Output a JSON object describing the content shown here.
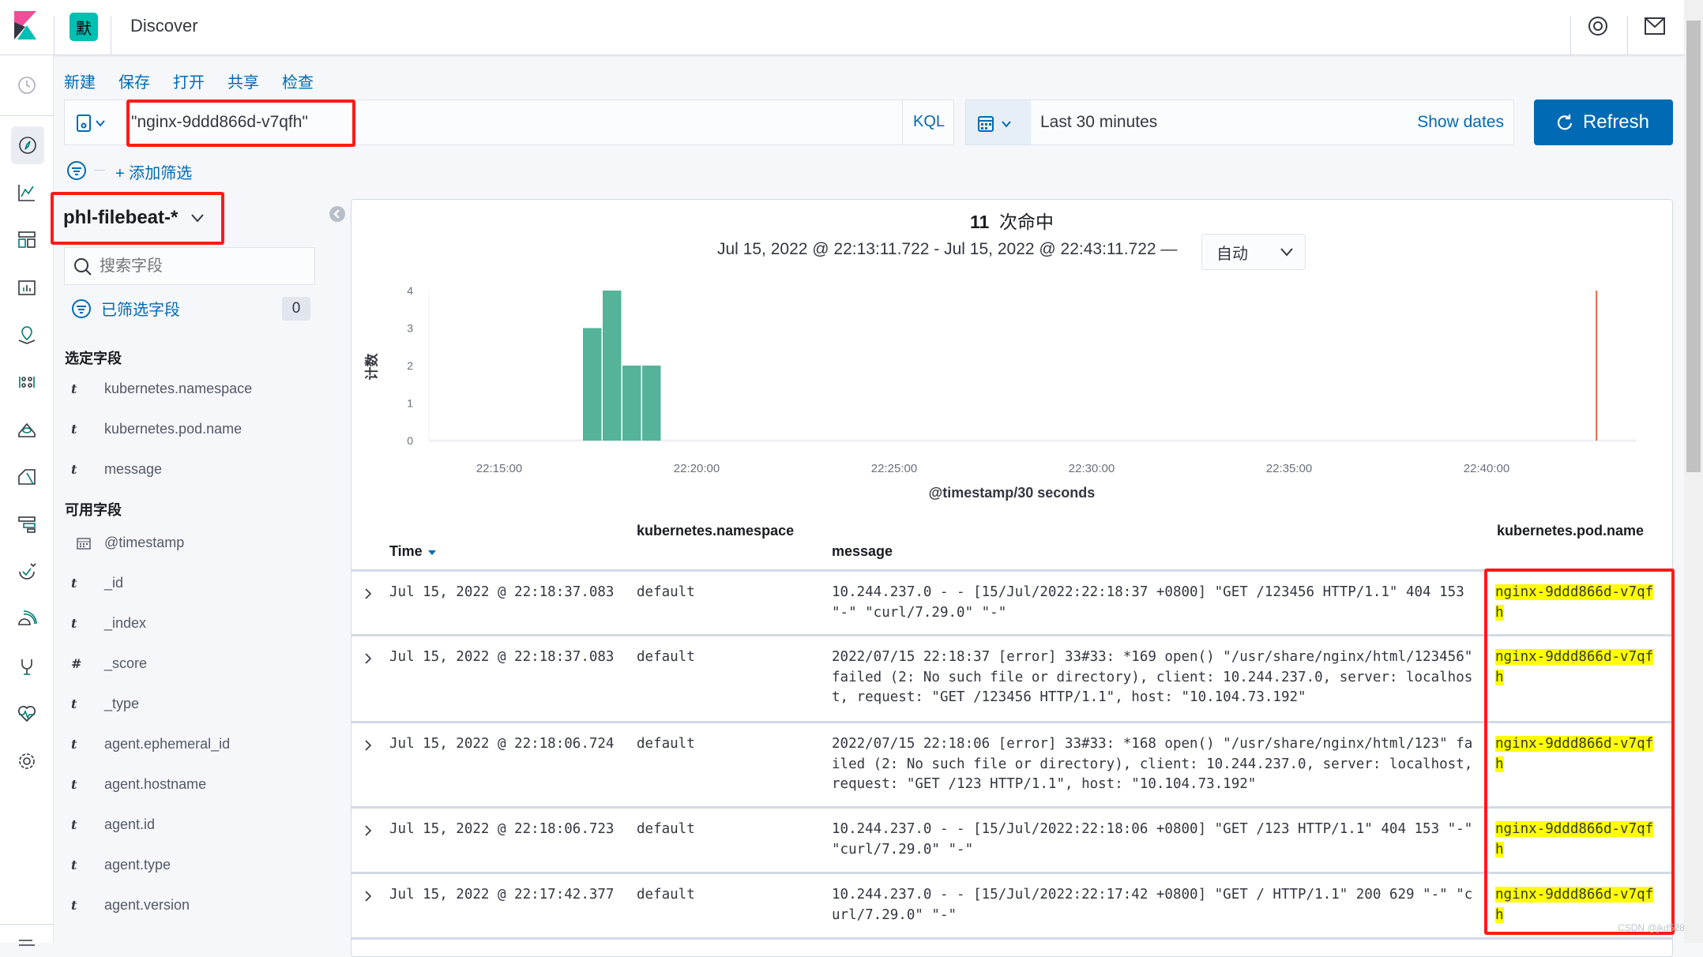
{
  "header": {
    "space_avatar": "默",
    "title": "Discover",
    "help_icon": "lifebuoy-icon",
    "mail_icon": "mail-icon"
  },
  "menu": {
    "new": "新建",
    "save": "保存",
    "open": "打开",
    "share": "共享",
    "inspect": "检查"
  },
  "query": {
    "value": "\"nginx-9ddd866d-v7qfh\"",
    "language": "KQL"
  },
  "time": {
    "range": "Last 30 minutes",
    "show_dates": "Show dates",
    "refresh": "Refresh"
  },
  "filter": {
    "add": "+ 添加筛选"
  },
  "sidebar": {
    "index_pattern": "phl-filebeat-*",
    "search_placeholder": "搜索字段",
    "filtered_label": "已筛选字段",
    "filtered_count": "0",
    "selected_title": "选定字段",
    "selected": [
      {
        "type": "t",
        "name": "kubernetes.namespace"
      },
      {
        "type": "t",
        "name": "kubernetes.pod.name"
      },
      {
        "type": "t",
        "name": "message"
      }
    ],
    "available_title": "可用字段",
    "available": [
      {
        "type": "date",
        "name": "@timestamp"
      },
      {
        "type": "t",
        "name": "_id"
      },
      {
        "type": "t",
        "name": "_index"
      },
      {
        "type": "#",
        "name": "_score"
      },
      {
        "type": "t",
        "name": "_type"
      },
      {
        "type": "t",
        "name": "agent.ephemeral_id"
      },
      {
        "type": "t",
        "name": "agent.hostname"
      },
      {
        "type": "t",
        "name": "agent.id"
      },
      {
        "type": "t",
        "name": "agent.type"
      },
      {
        "type": "t",
        "name": "agent.version"
      }
    ]
  },
  "hits": {
    "count": "11",
    "label": "次命中",
    "range": "Jul 15, 2022 @ 22:13:11.722 - Jul 15, 2022 @ 22:43:11.722 —",
    "interval": "自动"
  },
  "chart_data": {
    "type": "bar",
    "xlabel": "@timestamp/30 seconds",
    "ylabel": "计数",
    "x": [
      "22:17:30",
      "22:18:00",
      "22:18:30",
      "22:19:00"
    ],
    "values": [
      3,
      4,
      2,
      2
    ],
    "ylim": [
      0,
      4
    ],
    "yticks": [
      "0",
      "1",
      "2",
      "3",
      "4"
    ],
    "xticks": [
      "22:15:00",
      "22:20:00",
      "22:25:00",
      "22:30:00",
      "22:35:00",
      "22:40:00"
    ],
    "now_marker": "22:43:11",
    "bar_color": "#54b399",
    "marker_color": "#e7664c",
    "grid": false
  },
  "table": {
    "headers": {
      "time": "Time",
      "namespace": "kubernetes.namespace",
      "message": "message",
      "pod": "kubernetes.pod.name"
    },
    "rows": [
      {
        "time": "Jul 15, 2022 @ 22:18:37.083",
        "namespace": "default",
        "message": "10.244.237.0 - - [15/Jul/2022:22:18:37 +0800] \"GET /123456 HTTP/1.1\" 404 153 \"-\" \"curl/7.29.0\" \"-\"",
        "pod": "nginx-9ddd866d-v7qfh"
      },
      {
        "time": "Jul 15, 2022 @ 22:18:37.083",
        "namespace": "default",
        "message": "2022/07/15 22:18:37 [error] 33#33: *169 open() \"/usr/share/nginx/html/123456\" failed (2: No such file or directory), client: 10.244.237.0, server: localhost, request: \"GET /123456 HTTP/1.1\", host: \"10.104.73.192\"",
        "pod": "nginx-9ddd866d-v7qfh"
      },
      {
        "time": "Jul 15, 2022 @ 22:18:06.724",
        "namespace": "default",
        "message": "2022/07/15 22:18:06 [error] 33#33: *168 open() \"/usr/share/nginx/html/123\" failed (2: No such file or directory), client: 10.244.237.0, server: localhost, request: \"GET /123 HTTP/1.1\", host: \"10.104.73.192\"",
        "pod": "nginx-9ddd866d-v7qfh"
      },
      {
        "time": "Jul 15, 2022 @ 22:18:06.723",
        "namespace": "default",
        "message": "10.244.237.0 - - [15/Jul/2022:22:18:06 +0800] \"GET /123 HTTP/1.1\" 404 153 \"-\" \"curl/7.29.0\" \"-\"",
        "pod": "nginx-9ddd866d-v7qfh"
      },
      {
        "time": "Jul 15, 2022 @ 22:17:42.377",
        "namespace": "default",
        "message": "10.244.237.0 - - [15/Jul/2022:22:17:42 +0800] \"GET / HTTP/1.1\" 200 629 \"-\" \"curl/7.29.0\" \"-\"",
        "pod": "nginx-9ddd866d-v7qfh"
      }
    ]
  },
  "watermark": "CSDN @jkd528"
}
